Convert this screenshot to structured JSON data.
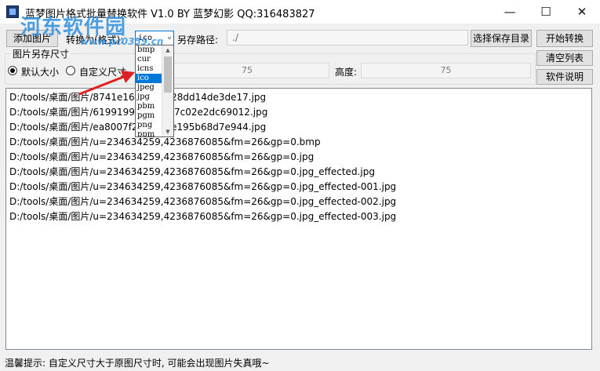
{
  "window": {
    "title": "蓝梦图片格式批量替换软件 V1.0 BY 蓝梦幻影 QQ:316483827",
    "minimize": "—",
    "maximize": "☐",
    "close": "✕"
  },
  "watermark": {
    "text": "河东软件园",
    "url": "www.pc0359.cn"
  },
  "toolbar": {
    "add_image": "添加图片",
    "convert_label": "转换为(格式):",
    "format_value": "ico",
    "format_options": [
      "bmp",
      "cur",
      "icns",
      "ico",
      "jpeg",
      "jpg",
      "pbm",
      "pgm",
      "png",
      "ppm"
    ],
    "save_path_label": "另存路径:",
    "save_path_value": "./",
    "choose_dir": "选择保存目录",
    "start": "开始转换"
  },
  "size_group": {
    "title": "图片另存尺寸",
    "default_size": "默认大小",
    "custom_size": "自定义尺寸",
    "width_value": "75",
    "height_label": "高度:",
    "height_value": "75"
  },
  "side_buttons": {
    "clear_list": "清空列表",
    "help": "软件说明"
  },
  "files": [
    "D:/tools/桌面/图片/8741e16f…a23328dd14de3de17.jpg",
    "D:/tools/桌面/图片/6199199…8897b7c02e2dc69012.jpg",
    "D:/tools/桌面/图片/ea8007f2…6279e195b68d7e944.jpg",
    "D:/tools/桌面/图片/u=234634259,4236876085&fm=26&gp=0.bmp",
    "D:/tools/桌面/图片/u=234634259,4236876085&fm=26&gp=0.jpg",
    "D:/tools/桌面/图片/u=234634259,4236876085&fm=26&gp=0.jpg_effected.jpg",
    "D:/tools/桌面/图片/u=234634259,4236876085&fm=26&gp=0.jpg_effected-001.jpg",
    "D:/tools/桌面/图片/u=234634259,4236876085&fm=26&gp=0.jpg_effected-002.jpg",
    "D:/tools/桌面/图片/u=234634259,4236876085&fm=26&gp=0.jpg_effected-003.jpg"
  ],
  "status": {
    "tip": "温馨提示: 自定义尺寸大于原图尺寸时, 可能会出现图片失真哦~"
  },
  "colors": {
    "accent": "#0078d7",
    "annotation_arrow": "#e02020",
    "watermark": "#2f8fe0"
  }
}
